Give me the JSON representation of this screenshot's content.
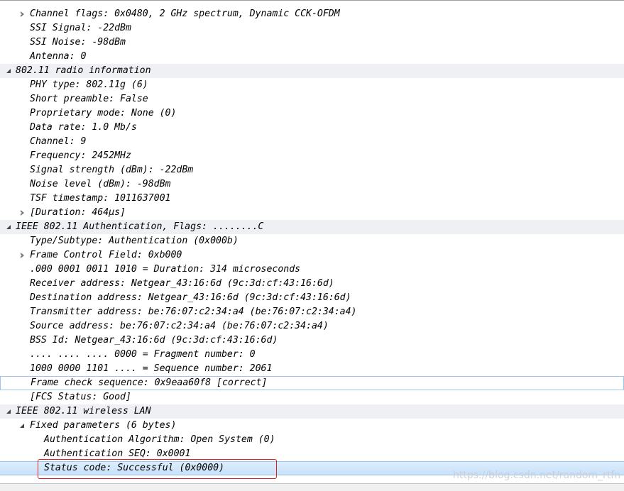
{
  "tree_rows": [
    {
      "text": "Channel flags: 0x0480, 2 GHz spectrum, Dynamic CCK-OFDM",
      "indent": 1,
      "toggle": "collapsed",
      "style": "normal"
    },
    {
      "text": "SSI Signal: -22dBm",
      "indent": 1,
      "toggle": "none",
      "style": "normal"
    },
    {
      "text": "SSI Noise: -98dBm",
      "indent": 1,
      "toggle": "none",
      "style": "normal"
    },
    {
      "text": "Antenna: 0",
      "indent": 1,
      "toggle": "none",
      "style": "normal"
    },
    {
      "text": "802.11 radio information",
      "indent": 0,
      "toggle": "expanded",
      "style": "header"
    },
    {
      "text": "PHY type: 802.11g (6)",
      "indent": 1,
      "toggle": "none",
      "style": "normal"
    },
    {
      "text": "Short preamble: False",
      "indent": 1,
      "toggle": "none",
      "style": "normal"
    },
    {
      "text": "Proprietary mode: None (0)",
      "indent": 1,
      "toggle": "none",
      "style": "normal"
    },
    {
      "text": "Data rate: 1.0 Mb/s",
      "indent": 1,
      "toggle": "none",
      "style": "normal"
    },
    {
      "text": "Channel: 9",
      "indent": 1,
      "toggle": "none",
      "style": "normal"
    },
    {
      "text": "Frequency: 2452MHz",
      "indent": 1,
      "toggle": "none",
      "style": "normal"
    },
    {
      "text": "Signal strength (dBm): -22dBm",
      "indent": 1,
      "toggle": "none",
      "style": "normal"
    },
    {
      "text": "Noise level (dBm): -98dBm",
      "indent": 1,
      "toggle": "none",
      "style": "normal"
    },
    {
      "text": "TSF timestamp: 1011637001",
      "indent": 1,
      "toggle": "none",
      "style": "normal"
    },
    {
      "text": "[Duration: 464µs]",
      "indent": 1,
      "toggle": "collapsed",
      "style": "normal"
    },
    {
      "text": "IEEE 802.11 Authentication, Flags: ........C",
      "indent": 0,
      "toggle": "expanded",
      "style": "header"
    },
    {
      "text": "Type/Subtype: Authentication (0x000b)",
      "indent": 1,
      "toggle": "none",
      "style": "normal"
    },
    {
      "text": "Frame Control Field: 0xb000",
      "indent": 1,
      "toggle": "collapsed",
      "style": "normal"
    },
    {
      "text": ".000 0001 0011 1010 = Duration: 314 microseconds",
      "indent": 1,
      "toggle": "none",
      "style": "normal"
    },
    {
      "text": "Receiver address: Netgear_43:16:6d (9c:3d:cf:43:16:6d)",
      "indent": 1,
      "toggle": "none",
      "style": "normal"
    },
    {
      "text": "Destination address: Netgear_43:16:6d (9c:3d:cf:43:16:6d)",
      "indent": 1,
      "toggle": "none",
      "style": "normal"
    },
    {
      "text": "Transmitter address: be:76:07:c2:34:a4 (be:76:07:c2:34:a4)",
      "indent": 1,
      "toggle": "none",
      "style": "normal"
    },
    {
      "text": "Source address: be:76:07:c2:34:a4 (be:76:07:c2:34:a4)",
      "indent": 1,
      "toggle": "none",
      "style": "normal"
    },
    {
      "text": "BSS Id: Netgear_43:16:6d (9c:3d:cf:43:16:6d)",
      "indent": 1,
      "toggle": "none",
      "style": "normal"
    },
    {
      "text": ".... .... .... 0000 = Fragment number: 0",
      "indent": 1,
      "toggle": "none",
      "style": "normal"
    },
    {
      "text": "1000 0000 1101 .... = Sequence number: 2061",
      "indent": 1,
      "toggle": "none",
      "style": "normal"
    },
    {
      "text": "Frame check sequence: 0x9eaa60f8 [correct]",
      "indent": 1,
      "toggle": "none",
      "style": "focused"
    },
    {
      "text": "[FCS Status: Good]",
      "indent": 1,
      "toggle": "none",
      "style": "normal"
    },
    {
      "text": "IEEE 802.11 wireless LAN",
      "indent": 0,
      "toggle": "expanded",
      "style": "header"
    },
    {
      "text": "Fixed parameters (6 bytes)",
      "indent": 1,
      "toggle": "expanded",
      "style": "normal"
    },
    {
      "text": "Authentication Algorithm: Open System (0)",
      "indent": 2,
      "toggle": "none",
      "style": "normal"
    },
    {
      "text": "Authentication SEQ: 0x0001",
      "indent": 2,
      "toggle": "none",
      "style": "normal"
    },
    {
      "text": "Status code: Successful (0x0000)",
      "indent": 2,
      "toggle": "none",
      "style": "selected"
    }
  ],
  "watermark": "https://blog.csdn.net/random_rtfn",
  "colors": {
    "header_bg": "#eef0f4",
    "selected_bg": "#c8e1fa",
    "highlight_border": "#e02020"
  }
}
